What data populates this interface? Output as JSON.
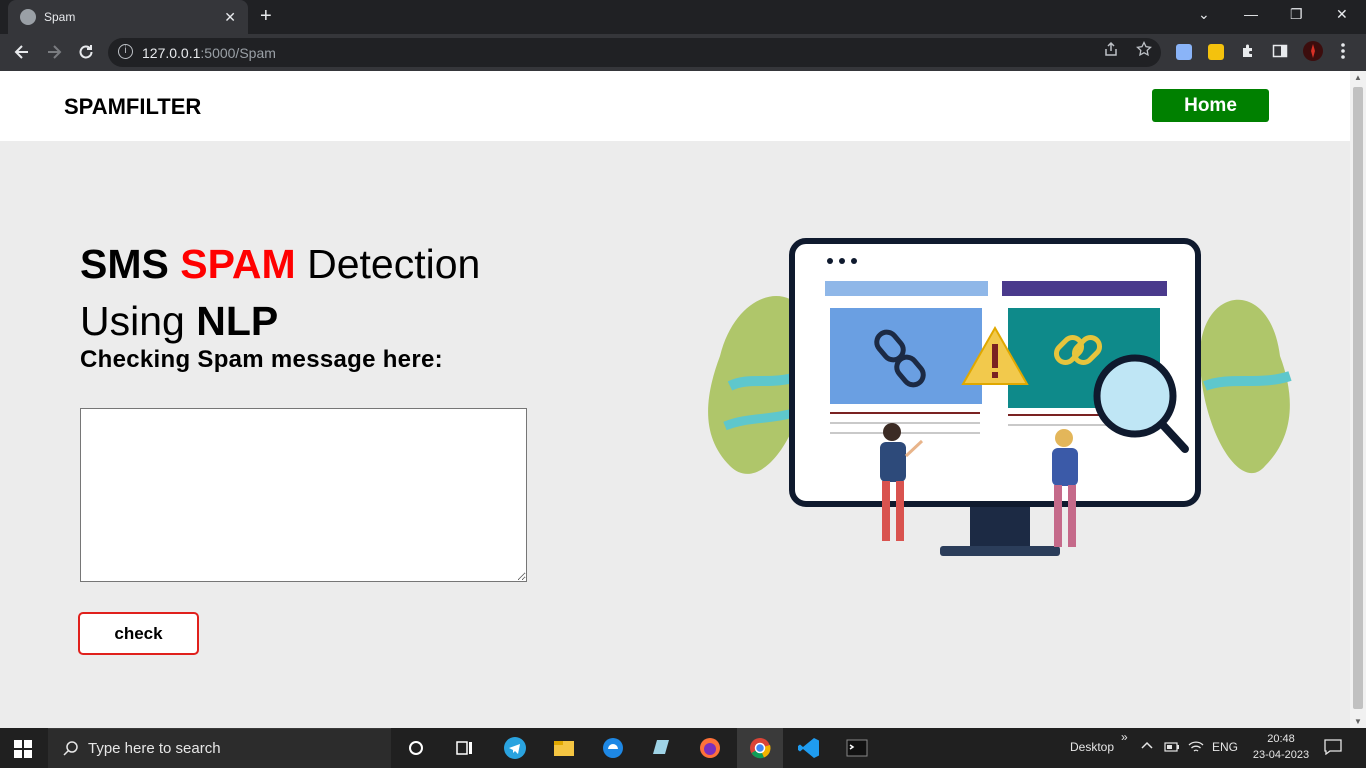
{
  "browser": {
    "tab_title": "Spam",
    "tab_close": "✕",
    "new_tab": "+",
    "url_host": "127.0.0.1",
    "url_path": ":5000/Spam",
    "window_controls": {
      "chevron": "⌄",
      "minimize": "—",
      "restore": "❐",
      "close": "✕"
    }
  },
  "navbar": {
    "brand": "SPAMFILTER",
    "home_label": "Home"
  },
  "hero": {
    "w1": "SMS",
    "w2": "SPAM",
    "w3": "Detection",
    "w4": "Using",
    "w5": "NLP",
    "subheading": "Checking Spam message here:",
    "message_value": "",
    "check_label": "check"
  },
  "taskbar": {
    "search_placeholder": "Type here to search",
    "desktop_label": "Desktop",
    "chevron": "»",
    "lang": "ENG",
    "time": "20:48",
    "date": "23-04-2023"
  },
  "colors": {
    "brand_green": "#008000",
    "spam_red": "#ff0000",
    "check_border": "#e0201c",
    "page_bg": "#ececec"
  }
}
